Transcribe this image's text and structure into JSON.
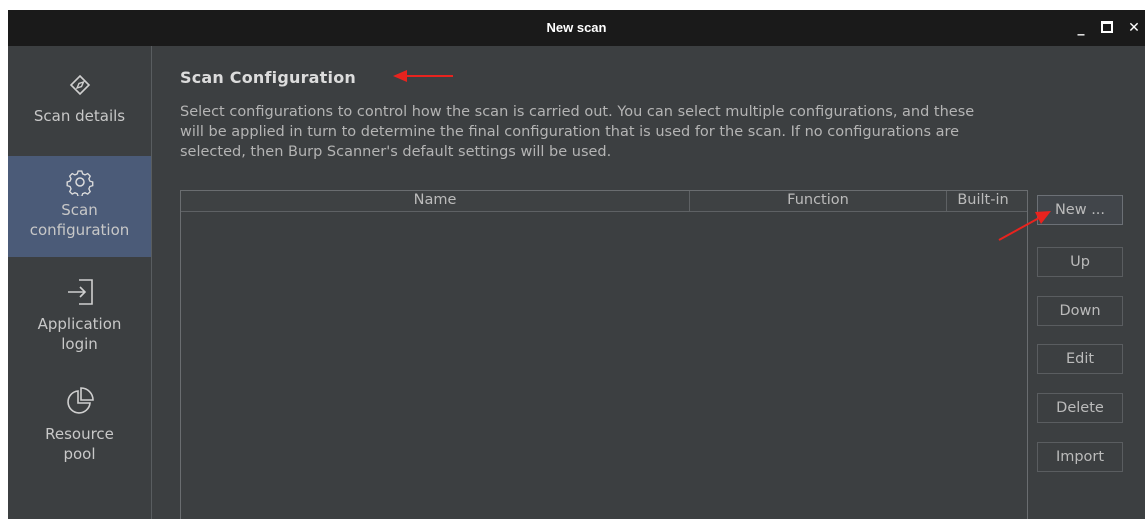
{
  "window": {
    "title": "New scan",
    "controls": {
      "minimize": "_",
      "close": "✕"
    }
  },
  "sidebar": {
    "items": [
      {
        "label": "Scan details",
        "icon": "compass-icon",
        "active": false
      },
      {
        "label": "Scan configuration",
        "line1": "Scan",
        "line2": "configuration",
        "icon": "gear-icon",
        "active": true
      },
      {
        "label": "Application login",
        "line1": "Application",
        "line2": "login",
        "icon": "login-arrow-icon",
        "active": false
      },
      {
        "label": "Resource pool",
        "line1": "Resource",
        "line2": "pool",
        "icon": "pie-chart-icon",
        "active": false
      }
    ]
  },
  "main": {
    "heading": "Scan Configuration",
    "description": "Select configurations to control how the scan is carried out. You can select multiple configurations, and these\nwill be applied in turn to determine the final configuration that is used for the scan. If no configurations are\nselected, then Burp Scanner's default settings will be used.",
    "table": {
      "columns": [
        "Name",
        "Function",
        "Built-in"
      ],
      "rows": []
    },
    "buttons": {
      "new": "New ...",
      "up": "Up",
      "down": "Down",
      "edit": "Edit",
      "delete": "Delete",
      "import": "Import"
    }
  },
  "colors": {
    "background": "#3c3f41",
    "titlebar": "#1a1a1a",
    "active_sidebar": "#4b5b78",
    "annotation_arrow": "#e8231e"
  }
}
